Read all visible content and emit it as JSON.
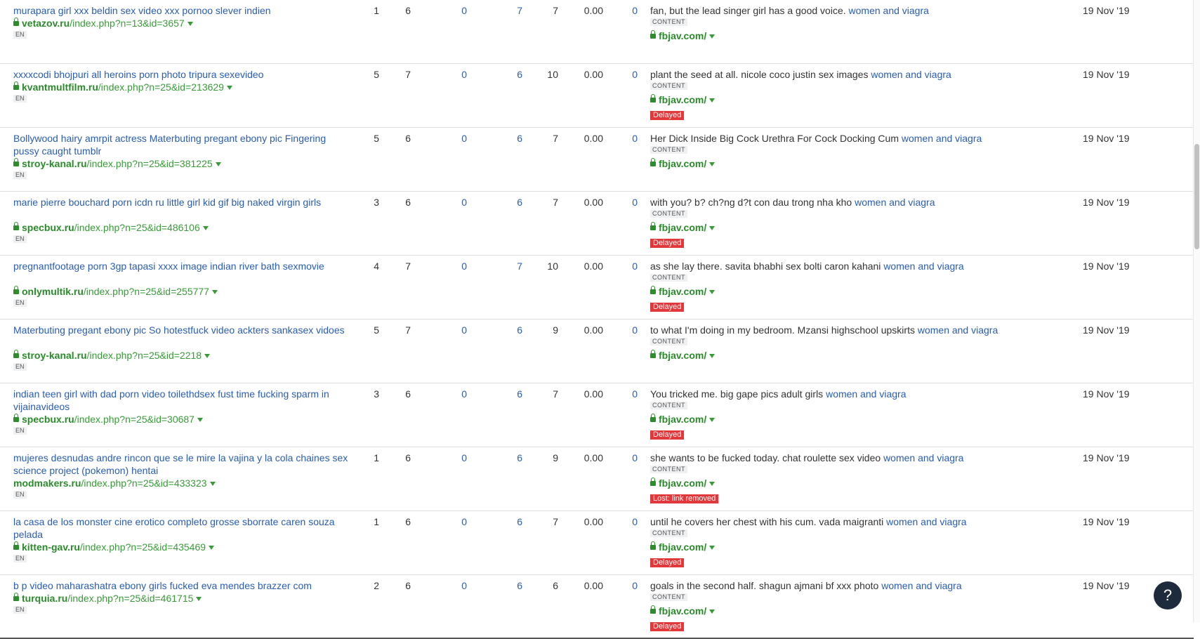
{
  "rows": [
    {
      "title": "murapara girl xxx beldin sex video xxx pornoo slever indien",
      "domain": "vetazov.ru",
      "path": "/index.php?n=13&id=3657",
      "lang": "EN",
      "dr": "1",
      "ur": "6",
      "c3": "0",
      "c4": "7",
      "c5": "7",
      "c6": "0.00",
      "c7": "0",
      "anchor": "fan, but the lead singer girl has a good voice. ",
      "kw": "women and viagra",
      "badge": "CONTENT",
      "target": "fbjav.com/",
      "status": "",
      "date": "19 Nov '19"
    },
    {
      "title": "xxxxcodi bhojpuri all heroins porn photo tripura sexevideo",
      "domain": "kvantmultfilm.ru",
      "path": "/index.php?n=25&id=213629",
      "lang": "EN",
      "dr": "5",
      "ur": "7",
      "c3": "0",
      "c4": "6",
      "c5": "10",
      "c6": "0.00",
      "c7": "0",
      "anchor": "plant the seed at all. nicole coco justin sex images ",
      "kw": "women and viagra",
      "badge": "CONTENT",
      "target": "fbjav.com/",
      "status": "Delayed",
      "date": "19 Nov '19"
    },
    {
      "title": "Bollywood hairy amrpit actress Materbuting pregant ebony pic Fingering pussy caught tumblr",
      "domain": "stroy-kanal.ru",
      "path": "/index.php?n=25&id=381225",
      "lang": "EN",
      "dr": "5",
      "ur": "6",
      "c3": "0",
      "c4": "6",
      "c5": "7",
      "c6": "0.00",
      "c7": "0",
      "anchor": "Her Dick Inside Big Cock Urethra For Cock Docking Cum ",
      "kw": "women and viagra",
      "badge": "CONTENT",
      "target": "fbjav.com/",
      "status": "",
      "date": "19 Nov '19"
    },
    {
      "title": "marie pierre bouchard porn icdn ru little girl kid gif big naked virgin girls",
      "domain": "specbux.ru",
      "path": "/index.php?n=25&id=486106",
      "lang": "EN",
      "dr": "3",
      "ur": "6",
      "c3": "0",
      "c4": "6",
      "c5": "7",
      "c6": "0.00",
      "c7": "0",
      "anchor": "with you? b? ch?ng d?t con dau trong nha kho ",
      "kw": "women and viagra",
      "badge": "CONTENT",
      "target": "fbjav.com/",
      "status": "Delayed",
      "date": "19 Nov '19"
    },
    {
      "title": "pregnantfootage porn 3gp tapasi xxxx image indian river bath sexmovie",
      "domain": "onlymultik.ru",
      "path": "/index.php?n=25&id=255777",
      "lang": "EN",
      "dr": "4",
      "ur": "7",
      "c3": "0",
      "c4": "7",
      "c5": "10",
      "c6": "0.00",
      "c7": "0",
      "anchor": "as she lay there. savita bhabhi sex bolti caron kahani ",
      "kw": "women and viagra",
      "badge": "CONTENT",
      "target": "fbjav.com/",
      "status": "Delayed",
      "date": "19 Nov '19"
    },
    {
      "title": "Materbuting pregant ebony pic So hotestfuck video ackters sankasex vidoes",
      "domain": "stroy-kanal.ru",
      "path": "/index.php?n=25&id=2218",
      "lang": "EN",
      "dr": "5",
      "ur": "7",
      "c3": "0",
      "c4": "6",
      "c5": "9",
      "c6": "0.00",
      "c7": "0",
      "anchor": "to what I'm doing in my bedroom. Mzansi highschool upskirts ",
      "kw": "women and viagra",
      "badge": "CONTENT",
      "target": "fbjav.com/",
      "status": "",
      "date": "19 Nov '19"
    },
    {
      "title": "indian teen girl with dad porn video toilethdsex fust time fucking sparm in vijainavideos",
      "domain": "specbux.ru",
      "path": "/index.php?n=25&id=30687",
      "lang": "EN",
      "dr": "3",
      "ur": "6",
      "c3": "0",
      "c4": "6",
      "c5": "7",
      "c6": "0.00",
      "c7": "0",
      "anchor": "You tricked me. big gape pics adult girls ",
      "kw": "women and viagra",
      "badge": "CONTENT",
      "target": "fbjav.com/",
      "status": "Delayed",
      "date": "19 Nov '19"
    },
    {
      "title": "mujeres desnudas andre rincon que se le mire la vajina y la cola chaines sex science project (pokemon) hentai",
      "domain": "modmakers.ru",
      "path": "/index.php?n=25&id=433323",
      "lang": "EN",
      "dr": "1",
      "ur": "6",
      "c3": "0",
      "c4": "6",
      "c5": "9",
      "c6": "0.00",
      "c7": "0",
      "anchor": "she wants to be fucked today. chat roulette sex video ",
      "kw": "women and viagra",
      "badge": "CONTENT",
      "target": "fbjav.com/",
      "status": "Lost: link removed",
      "date": "19 Nov '19",
      "nolock": true
    },
    {
      "title": "la casa de los monster cine erotico completo grosse sborrate caren souza pelada",
      "domain": "kitten-gav.ru",
      "path": "/index.php?n=25&id=435469",
      "lang": "EN",
      "dr": "1",
      "ur": "6",
      "c3": "0",
      "c4": "6",
      "c5": "7",
      "c6": "0.00",
      "c7": "0",
      "anchor": "until he covers her chest with his cum. vada maigranti ",
      "kw": "women and viagra",
      "badge": "CONTENT",
      "target": "fbjav.com/",
      "status": "Delayed",
      "date": "19 Nov '19"
    },
    {
      "title": "b p video maharashatra ebony girls fucked eva mendes brazzer com",
      "domain": "turquia.ru",
      "path": "/index.php?n=25&id=461715",
      "lang": "EN",
      "dr": "2",
      "ur": "6",
      "c3": "0",
      "c4": "6",
      "c5": "6",
      "c6": "0.00",
      "c7": "0",
      "anchor": "goals in the second half. shagun ajmani bf xxx photo ",
      "kw": "women and viagra",
      "badge": "CONTENT",
      "target": "fbjav.com/",
      "status": "Delayed",
      "date": "19 Nov '19"
    }
  ],
  "help_label": "?"
}
